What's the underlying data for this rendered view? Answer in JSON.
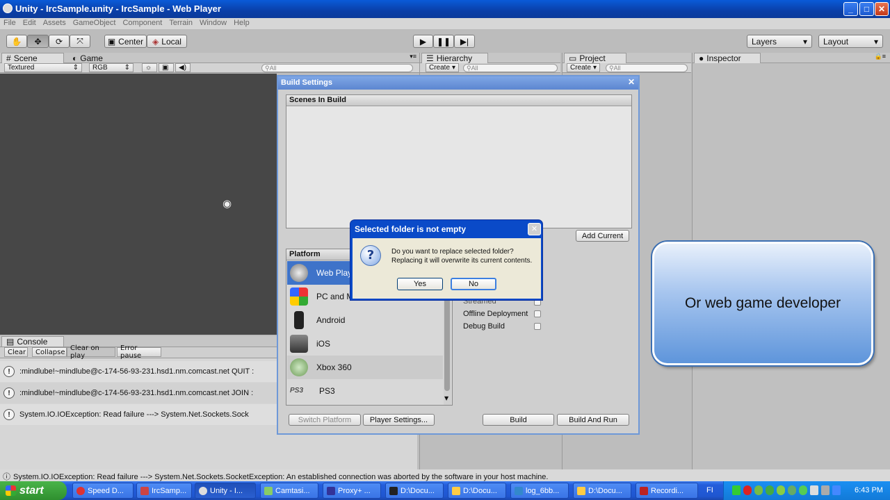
{
  "window": {
    "title": "Unity - IrcSample.unity - IrcSample - Web Player",
    "min": "_",
    "max": "□",
    "close": "✕"
  },
  "menu": [
    "File",
    "Edit",
    "Assets",
    "GameObject",
    "Component",
    "Terrain",
    "Window",
    "Help"
  ],
  "toolbar": {
    "center": "Center",
    "local": "Local",
    "layers": "Layers",
    "layout": "Layout"
  },
  "scene": {
    "tab": "Scene",
    "game_tab": "Game",
    "textured": "Textured",
    "rgb": "RGB",
    "search_placeholder": "All"
  },
  "hierarchy": {
    "tab": "Hierarchy",
    "create": "Create",
    "search_placeholder": "All"
  },
  "project": {
    "tab": "Project",
    "create": "Create",
    "search_placeholder": "All"
  },
  "inspector": {
    "tab": "Inspector"
  },
  "build": {
    "title": "Build Settings",
    "scenes_header": "Scenes In Build",
    "add_current": "Add Current",
    "platform_header": "Platform",
    "platforms": [
      "Web Player",
      "PC and Mac Standalone",
      "Android",
      "iOS",
      "Xbox 360",
      "PS3"
    ],
    "options": [
      "Streamed",
      "Offline Deployment",
      "Debug Build"
    ],
    "switch_platform": "Switch Platform",
    "player_settings": "Player Settings...",
    "build": "Build",
    "build_and_run": "Build And Run"
  },
  "dialog": {
    "title": "Selected folder is not empty",
    "line1": "Do you want to replace selected folder?",
    "line2": "Replacing it will overwrite its current contents.",
    "yes": "Yes",
    "no": "No"
  },
  "console": {
    "tab": "Console",
    "buttons": [
      "Clear",
      "Collapse",
      "Clear on play",
      "Error pause"
    ],
    "rows": [
      ":mindlube!~mindlube@c-174-56-93-231.hsd1.nm.comcast.net QUIT :",
      ":mindlube!~mindlube@c-174-56-93-231.hsd1.nm.comcast.net JOIN :",
      "System.IO.IOException: Read failure ---> System.Net.Sockets.Sock"
    ]
  },
  "callout": {
    "text": "Or web game developer"
  },
  "status": {
    "text": "System.IO.IOException: Read failure ---> System.Net.Sockets.SocketException: An established connection was aborted by the software in your host machine."
  },
  "taskbar": {
    "start": "start",
    "tasks": [
      "Speed D...",
      "IrcSamp...",
      "Unity - I...",
      "Camtasi...",
      "Proxy+ ...",
      "D:\\Docu...",
      "D:\\Docu...",
      "log_6bb...",
      "D:\\Docu...",
      "Recordi..."
    ],
    "lang": "FI",
    "clock": "6:43 PM"
  },
  "colors": {
    "accent": "#0a4ac8",
    "callout": "#5e95db",
    "scene_bg": "#474747"
  }
}
